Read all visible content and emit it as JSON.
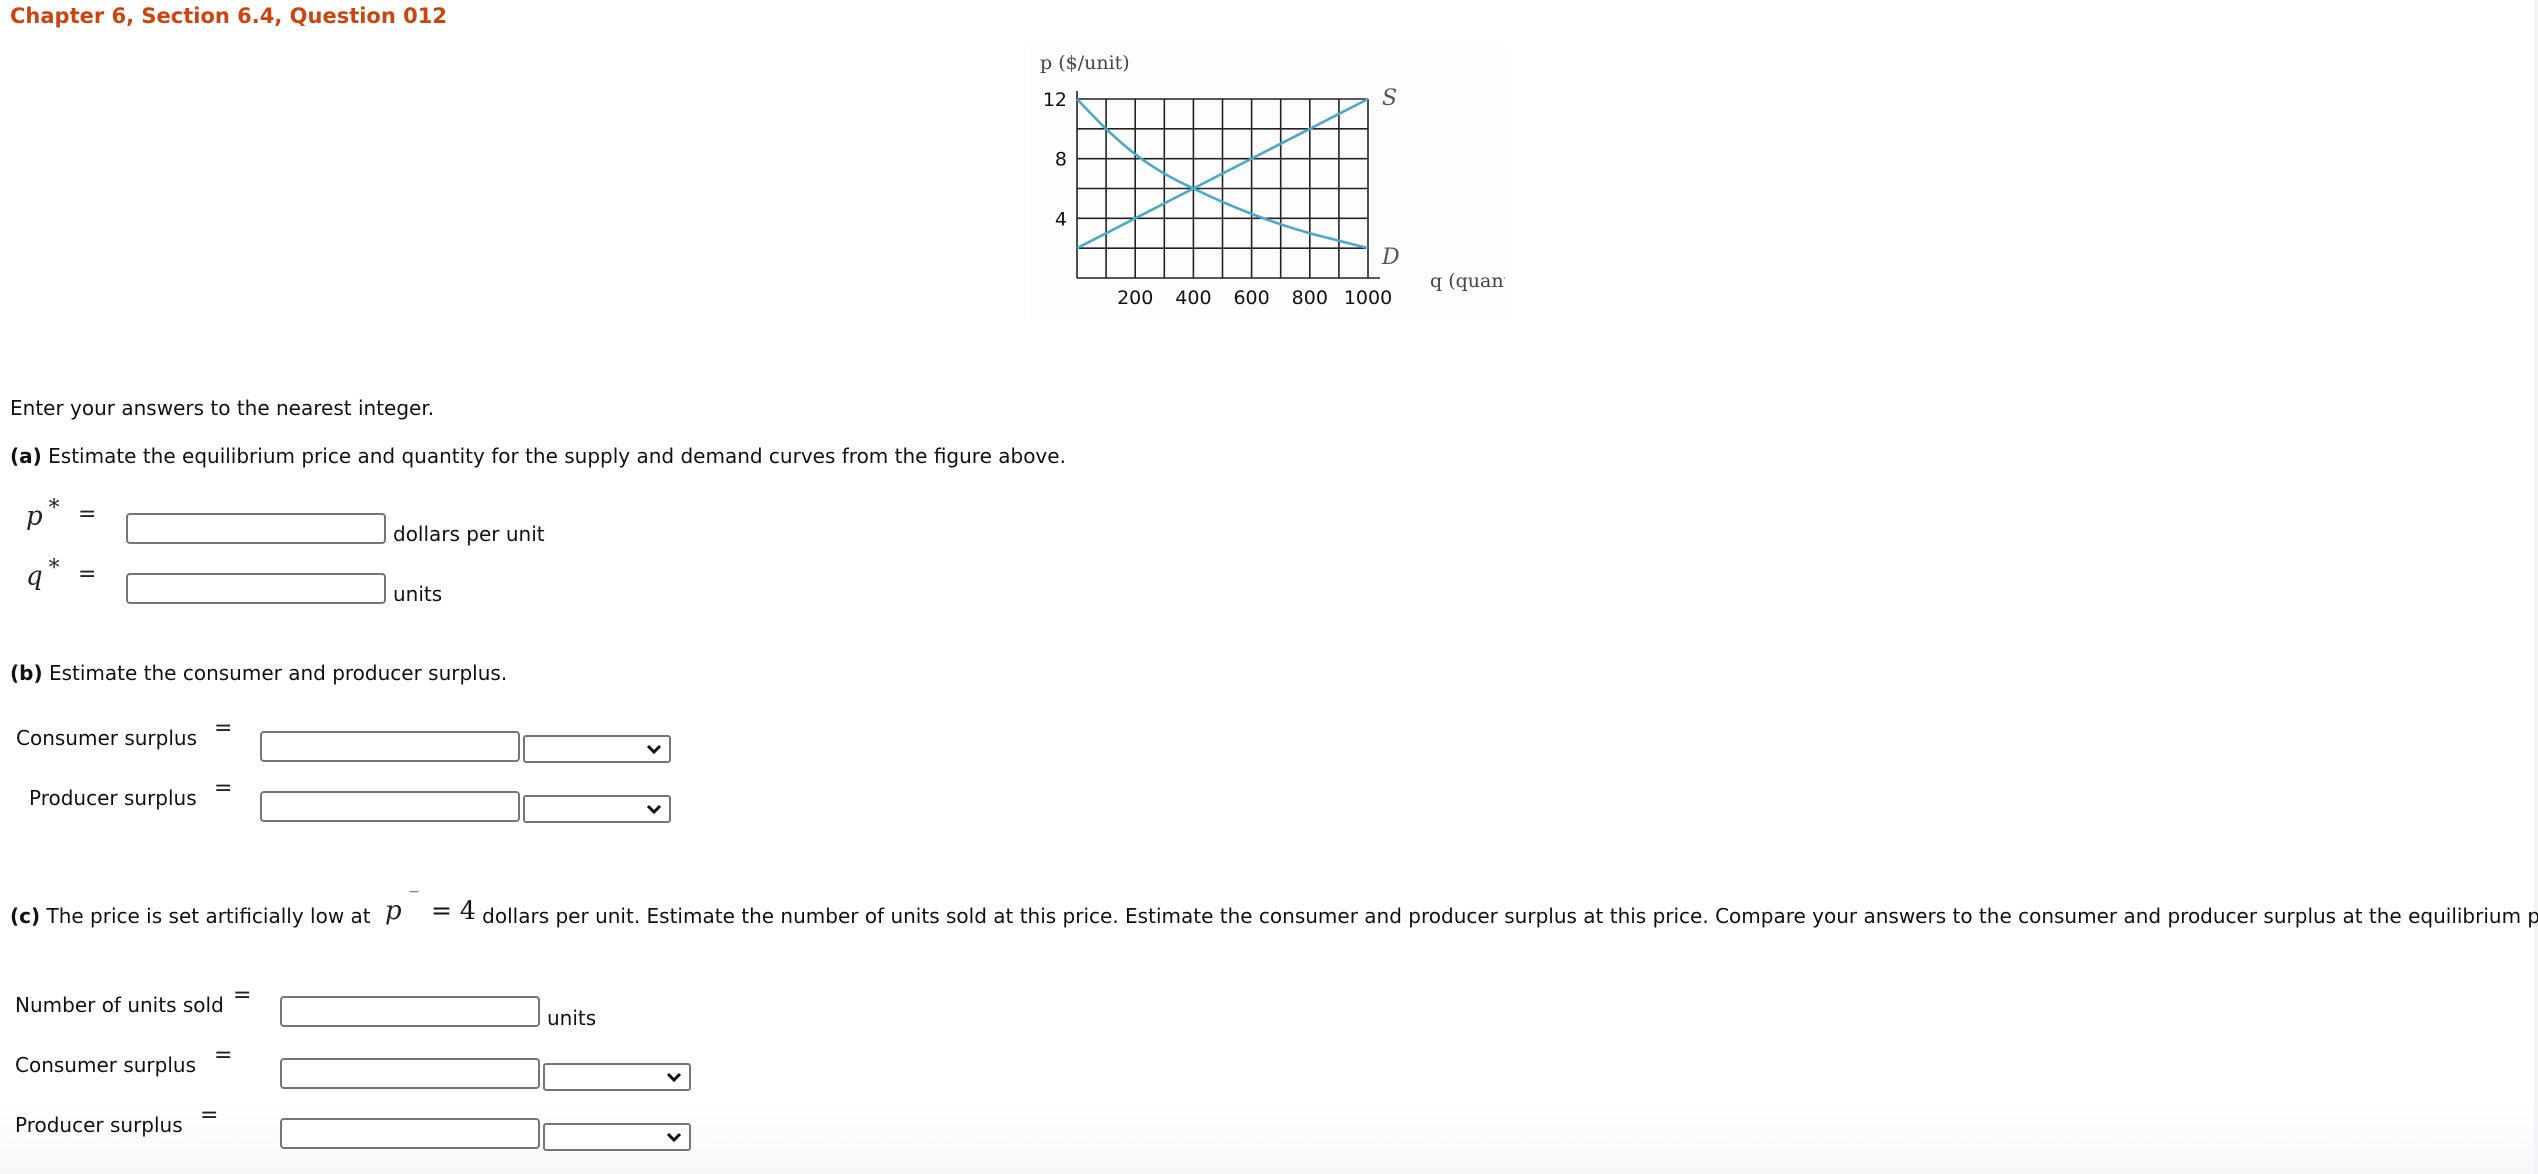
{
  "header": {
    "title": "Chapter 6, Section 6.4, Question 012"
  },
  "chart_data": {
    "type": "line",
    "title": "",
    "xlabel": "q (quantity)",
    "ylabel": "p ($/unit)",
    "xlim": [
      0,
      1000
    ],
    "ylim": [
      0,
      12
    ],
    "x_ticks": [
      200,
      400,
      600,
      800,
      1000
    ],
    "y_ticks": [
      4,
      8,
      12
    ],
    "grid": true,
    "grid_x_step": 100,
    "grid_y_step": 2,
    "series": [
      {
        "name": "S",
        "label": "S",
        "x": [
          0,
          1000
        ],
        "values": [
          2,
          12
        ]
      },
      {
        "name": "D",
        "label": "D",
        "x": [
          0,
          100,
          200,
          300,
          400,
          500,
          600,
          700,
          800,
          900,
          1000
        ],
        "values": [
          12,
          10,
          8.3,
          7,
          6,
          5.1,
          4.3,
          3.6,
          3.0,
          2.5,
          2
        ]
      }
    ],
    "colors": {
      "curve": "#4aa8c8",
      "grid": "#222222"
    }
  },
  "instructions": "Enter your answers to the nearest integer.",
  "part_a": {
    "label": "(a)",
    "text": " Estimate the equilibrium price and quantity for the supply and demand curves from the figure above.",
    "rows": [
      {
        "symbol": "p",
        "star": "*",
        "eq": "=",
        "value": "",
        "unit": "dollars per unit"
      },
      {
        "symbol": "q",
        "star": "*",
        "eq": "=",
        "value": "",
        "unit": "units"
      }
    ]
  },
  "part_b": {
    "label": "(b)",
    "text": " Estimate the consumer and producer surplus.",
    "rows": [
      {
        "label": "Consumer surplus",
        "eq": "=",
        "value": "",
        "select": ""
      },
      {
        "label": "Producer surplus",
        "eq": "=",
        "value": "",
        "select": ""
      }
    ]
  },
  "part_c": {
    "label": "(c)",
    "text_before": " The price is set artificially low at ",
    "price_symbol": "p",
    "price_bar": "‾",
    "price_eq": "= 4",
    "text_after": " dollars per unit. Estimate the number of units sold at this price. Estimate the consumer and producer surplus at this price. Compare your answers to the consumer and producer surplus at the equilibrium price.",
    "rows": [
      {
        "label": "Number of units sold",
        "eq": "=",
        "value": "",
        "unit": "units"
      },
      {
        "label": "Consumer surplus",
        "eq": "=",
        "value": "",
        "select": ""
      },
      {
        "label": "Producer surplus",
        "eq": "=",
        "value": "",
        "select": ""
      }
    ]
  }
}
